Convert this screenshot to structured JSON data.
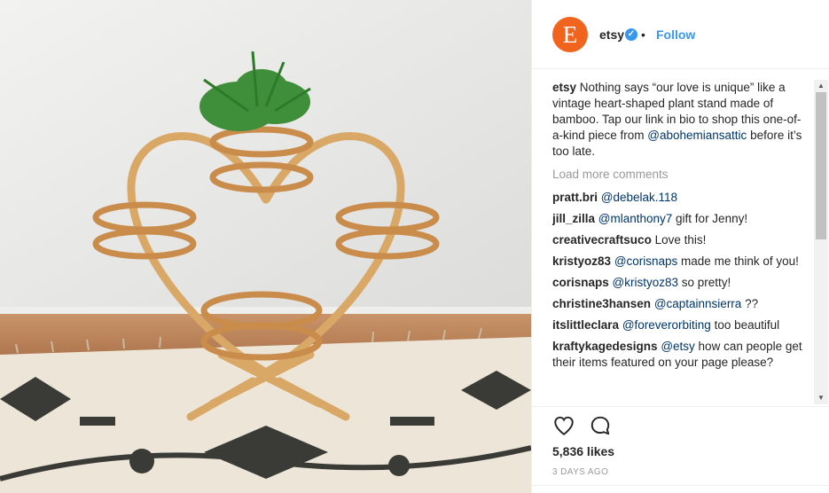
{
  "post": {
    "avatar_letter": "E",
    "username": "etsy",
    "verified_mark": "✓",
    "separator": "•",
    "follow_label": "Follow",
    "brand_color": "#f1641e",
    "link_color": "#3897f0"
  },
  "caption": {
    "user": "etsy",
    "text_before": " Nothing says “our love is unique” like a vintage heart-shaped plant stand made of bamboo. Tap our link in bio to shop this one-of-a-kind piece from ",
    "mention": "@abohemiansattic",
    "text_after": " before it’s too late."
  },
  "load_more_label": "Load more comments",
  "comments": [
    {
      "user": "pratt.bri",
      "mention": "@debelak.118",
      "text": ""
    },
    {
      "user": "jill_zilla",
      "mention": "@mlanthony7",
      "text": " gift for Jenny!"
    },
    {
      "user": "creativecraftsuco",
      "mention": "",
      "text": " Love this!"
    },
    {
      "user": "kristyoz83",
      "mention": "@corisnaps",
      "text": " made me think of you!"
    },
    {
      "user": "corisnaps",
      "mention": "@kristyoz83",
      "text": " so pretty!"
    },
    {
      "user": "christine3hansen",
      "mention": "@captainnsierra",
      "text": " ??"
    },
    {
      "user": "itslittleclara",
      "mention": "@foreverorbiting",
      "text": " too beautiful"
    },
    {
      "user": "kraftykagedesigns",
      "mention": "@etsy",
      "text": " how can people get their items featured on your page please?"
    }
  ],
  "scroll": {
    "up_arrow": "▲",
    "down_arrow": "▼"
  },
  "actions": {
    "like_icon": "heart-outline-icon",
    "comment_icon": "comment-bubble-icon"
  },
  "likes": "5,836 likes",
  "timestamp": "3 DAYS AGO"
}
